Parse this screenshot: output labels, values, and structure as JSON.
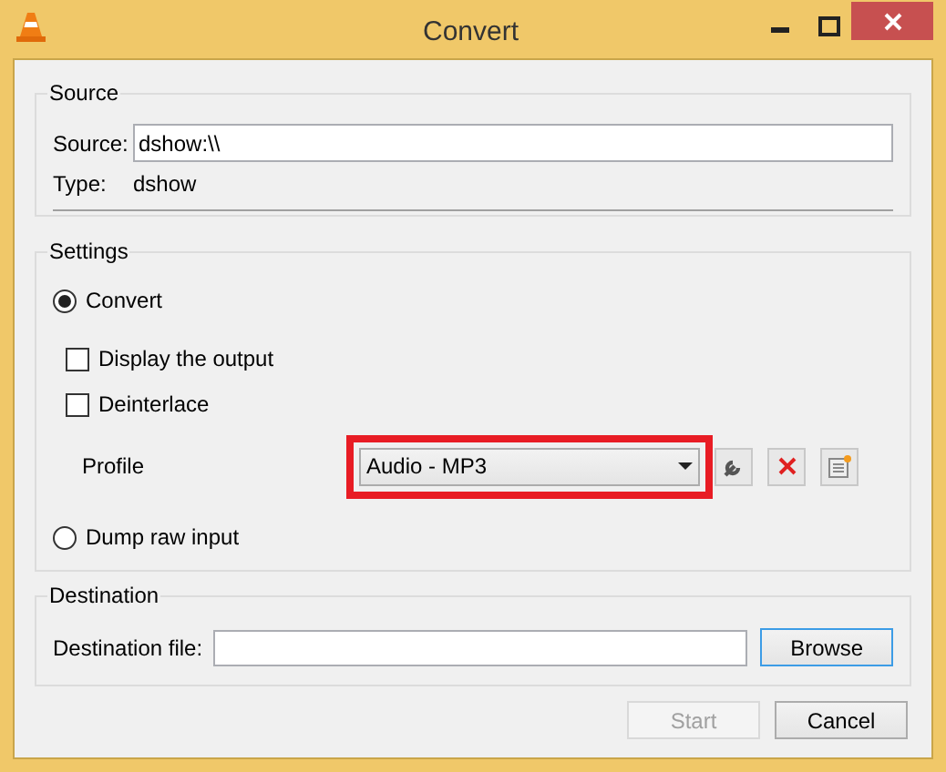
{
  "window": {
    "title": "Convert"
  },
  "source": {
    "heading": "Source",
    "source_label": "Source:",
    "source_value": "dshow:\\\\",
    "type_label": "Type:",
    "type_value": "dshow"
  },
  "settings": {
    "heading": "Settings",
    "modes": [
      {
        "label": "Convert",
        "selected": true
      },
      {
        "label": "Dump raw input",
        "selected": false
      }
    ],
    "options": [
      {
        "label": "Display the output",
        "checked": false
      },
      {
        "label": "Deinterlace",
        "checked": false
      }
    ],
    "profile": {
      "label": "Profile",
      "value": "Audio - MP3",
      "highlighted": true
    }
  },
  "destination": {
    "heading": "Destination",
    "label": "Destination file:",
    "button": "Browse"
  },
  "buttons": [
    {
      "label": "Start",
      "disabled": true
    },
    {
      "label": "Cancel",
      "disabled": false
    }
  ]
}
